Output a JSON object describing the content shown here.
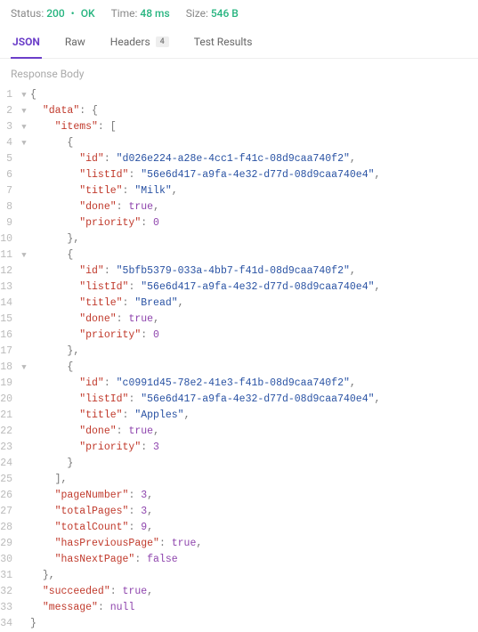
{
  "stats": {
    "statusLabel": "Status:",
    "statusCode": "200",
    "statusText": "OK",
    "timeLabel": "Time:",
    "timeValue": "48 ms",
    "sizeLabel": "Size:",
    "sizeValue": "546 B"
  },
  "tabs": {
    "json": "JSON",
    "raw": "Raw",
    "headers": "Headers",
    "headersCount": "4",
    "testResults": "Test Results"
  },
  "subLabel": "Response Body",
  "json": {
    "data": {
      "items": [
        {
          "id": "d026e224-a28e-4cc1-f41c-08d9caa740f2",
          "listId": "56e6d417-a9fa-4e32-d77d-08d9caa740e4",
          "title": "Milk",
          "done": true,
          "priority": 0
        },
        {
          "id": "5bfb5379-033a-4bb7-f41d-08d9caa740f2",
          "listId": "56e6d417-a9fa-4e32-d77d-08d9caa740e4",
          "title": "Bread",
          "done": true,
          "priority": 0
        },
        {
          "id": "c0991d45-78e2-41e3-f41b-08d9caa740f2",
          "listId": "56e6d417-a9fa-4e32-d77d-08d9caa740e4",
          "title": "Apples",
          "done": true,
          "priority": 3
        }
      ],
      "pageNumber": 3,
      "totalPages": 3,
      "totalCount": 9,
      "hasPreviousPage": true,
      "hasNextPage": false
    },
    "succeeded": true,
    "message": null
  },
  "foldGlyph": "▼"
}
